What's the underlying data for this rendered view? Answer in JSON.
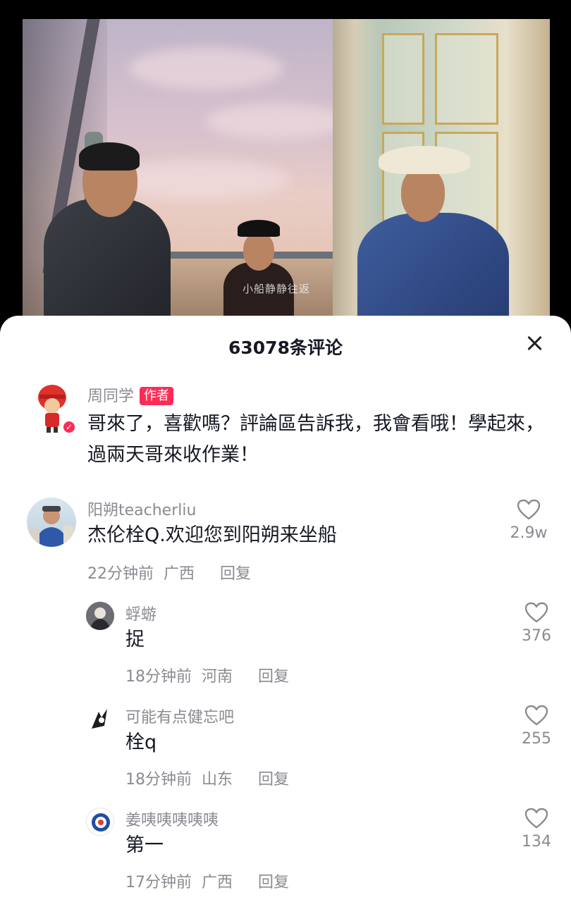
{
  "video": {
    "watermark": "小船静静往返"
  },
  "comments_panel": {
    "title": "63078条评论",
    "close_icon": "close-icon",
    "author_comment": {
      "username": "周同学",
      "badge": "作者",
      "text": "哥來了，喜歡嗎？評論區告訴我，我會看哦！學起來，過兩天哥來收作業！"
    },
    "comments": [
      {
        "username": "阳朔teacherliu",
        "text": "杰伦栓Q.欢迎您到阳朔来坐船",
        "time": "22分钟前",
        "location": "广西",
        "reply": "回复",
        "likes": "2.9w"
      }
    ],
    "replies": [
      {
        "username": "蜉蝣",
        "text": "捉",
        "time": "18分钟前",
        "location": "河南",
        "reply": "回复",
        "likes": "376"
      },
      {
        "username": "可能有点健忘吧",
        "text": "栓q",
        "time": "18分钟前",
        "location": "山东",
        "reply": "回复",
        "likes": "255"
      },
      {
        "username": "姜咦咦咦咦咦",
        "text": "第一",
        "time": "17分钟前",
        "location": "广西",
        "reply": "回复",
        "likes": "134"
      }
    ]
  },
  "colors": {
    "accent": "#fe2c55",
    "text_primary": "#161823",
    "text_secondary": "#8a8b91"
  }
}
